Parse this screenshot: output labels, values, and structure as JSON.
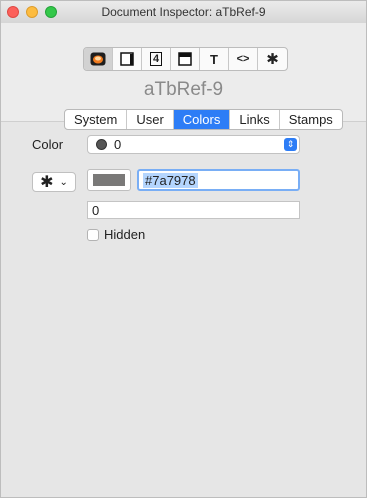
{
  "window": {
    "title": "Document Inspector: aTbRef-9"
  },
  "toolbar": {
    "buttons": [
      {
        "icon": "document-icon",
        "glyph": ""
      },
      {
        "icon": "page-icon",
        "glyph": ""
      },
      {
        "icon": "number-icon",
        "glyph": "4"
      },
      {
        "icon": "window-icon",
        "glyph": ""
      },
      {
        "icon": "text-icon",
        "glyph": "T"
      },
      {
        "icon": "code-icon",
        "glyph": "<>"
      },
      {
        "icon": "gear-icon",
        "glyph": "✱"
      }
    ]
  },
  "document": {
    "name": "aTbRef-9"
  },
  "tabs": [
    "System",
    "User",
    "Colors",
    "Links",
    "Stamps"
  ],
  "active_tab": "Colors",
  "color": {
    "label": "Color",
    "selected_value": "0",
    "hex_value": "#7a7978",
    "opacity_value": "0",
    "hidden_label": "Hidden",
    "swatch_color": "#7a7978"
  },
  "colors": {
    "accent": "#2d7df6"
  }
}
